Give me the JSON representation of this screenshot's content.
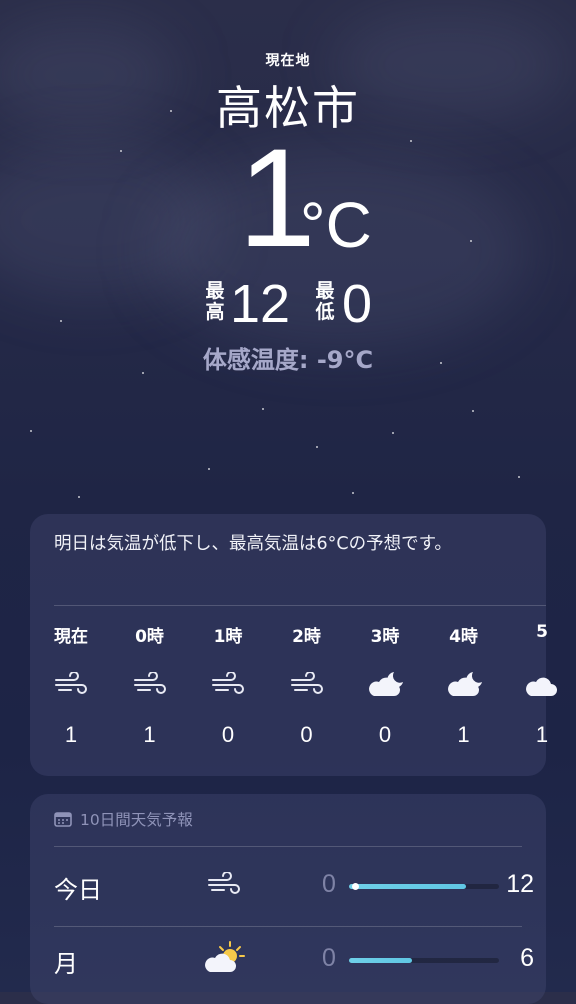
{
  "header": {
    "location_label": "現在地",
    "city": "高松市",
    "temperature": "1",
    "unit": "°C",
    "high_label": "最高",
    "high_value": "12",
    "low_label": "最低",
    "low_value": "0",
    "feels_like": "体感温度: -9°C"
  },
  "hourly": {
    "summary": "明日は気温が低下し、最高気温は6°Cの予想です。",
    "items": [
      {
        "label": "現在",
        "icon": "wind-icon",
        "temp": "1"
      },
      {
        "label": "0時",
        "icon": "wind-icon",
        "temp": "1"
      },
      {
        "label": "1時",
        "icon": "wind-icon",
        "temp": "0"
      },
      {
        "label": "2時",
        "icon": "wind-icon",
        "temp": "0"
      },
      {
        "label": "3時",
        "icon": "cloud-moon-icon",
        "temp": "0"
      },
      {
        "label": "4時",
        "icon": "cloud-moon-icon",
        "temp": "1"
      },
      {
        "label": "5",
        "icon": "cloud-icon",
        "temp": "1"
      }
    ]
  },
  "forecast": {
    "title": "10日間天気予報",
    "days": [
      {
        "day": "今日",
        "icon": "wind-icon",
        "low": "0",
        "high": "12",
        "range_start": 0.0,
        "range_end": 0.78,
        "current_marker": 0.02
      },
      {
        "day": "月",
        "icon": "partly-sunny-icon",
        "low": "0",
        "high": "6",
        "range_start": 0.0,
        "range_end": 0.42
      }
    ]
  },
  "colors": {
    "range_bar": "#6fd0e8",
    "muted_text": "#a6a8c9"
  }
}
